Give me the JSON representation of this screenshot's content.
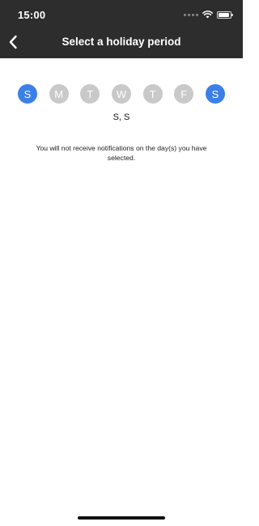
{
  "status_bar": {
    "time": "15:00",
    "icons": [
      "signal-dots-icon",
      "wifi-icon",
      "battery-icon"
    ]
  },
  "header": {
    "title": "Select a holiday period",
    "back_icon": "chevron-left-icon",
    "background": "#2d2d2d"
  },
  "days": [
    {
      "label": "S",
      "selected": true
    },
    {
      "label": "M",
      "selected": false
    },
    {
      "label": "T",
      "selected": false
    },
    {
      "label": "W",
      "selected": false
    },
    {
      "label": "T",
      "selected": false
    },
    {
      "label": "F",
      "selected": false
    },
    {
      "label": "S",
      "selected": true
    }
  ],
  "selected_summary": "S, S",
  "note": "You will not receive notifications on the day(s) you have selected.",
  "colors": {
    "selected_day": "#3b7fe8",
    "unselected_day": "#c9c9c9"
  }
}
